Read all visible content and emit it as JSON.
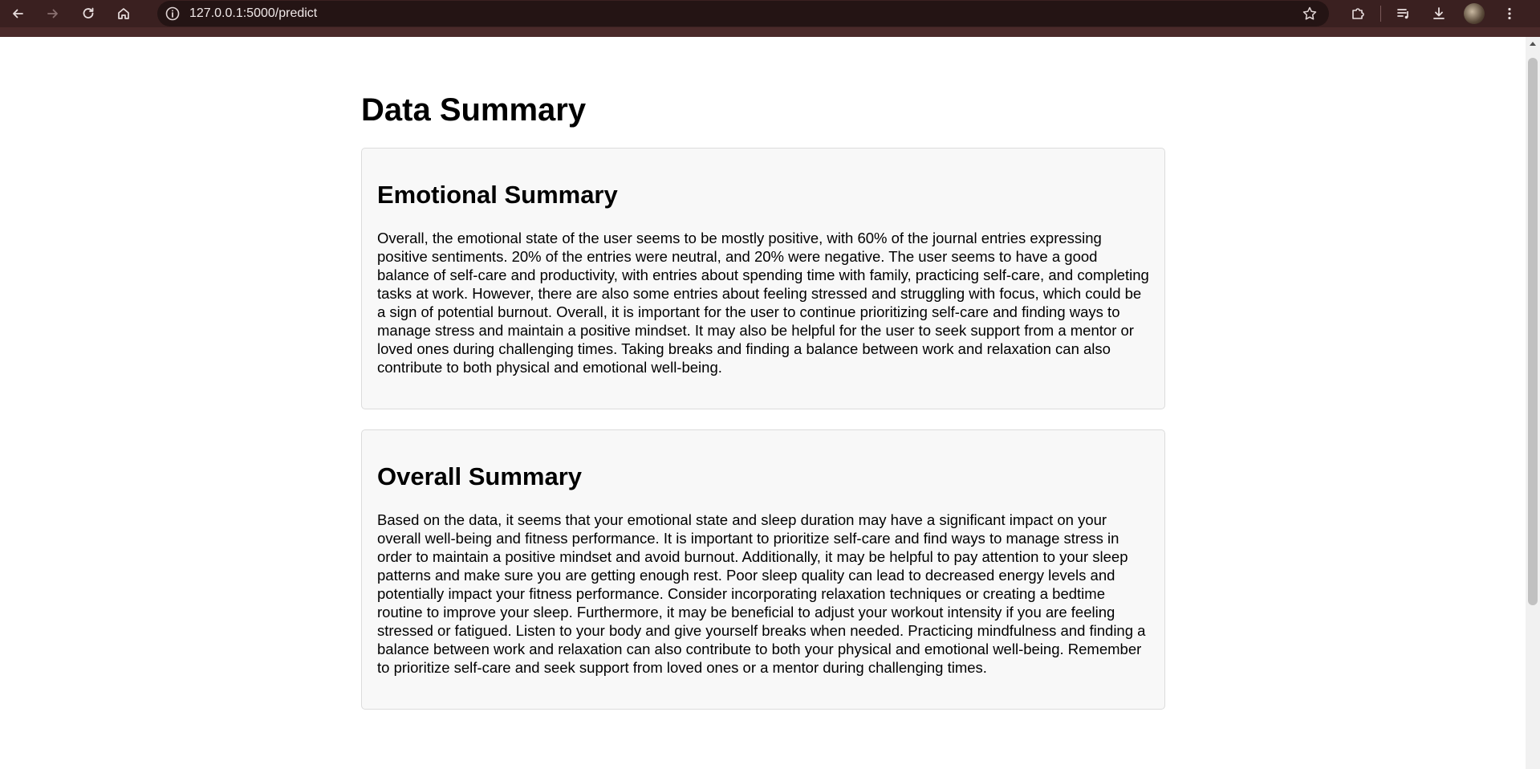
{
  "browser": {
    "url": "127.0.0.1:5000/predict"
  },
  "page": {
    "title": "Data Summary",
    "sections": [
      {
        "heading": "Emotional Summary",
        "body": "Overall, the emotional state of the user seems to be mostly positive, with 60% of the journal entries expressing positive sentiments. 20% of the entries were neutral, and 20% were negative. The user seems to have a good balance of self-care and productivity, with entries about spending time with family, practicing self-care, and completing tasks at work. However, there are also some entries about feeling stressed and struggling with focus, which could be a sign of potential burnout. Overall, it is important for the user to continue prioritizing self-care and finding ways to manage stress and maintain a positive mindset. It may also be helpful for the user to seek support from a mentor or loved ones during challenging times. Taking breaks and finding a balance between work and relaxation can also contribute to both physical and emotional well-being."
      },
      {
        "heading": "Overall Summary",
        "body": "Based on the data, it seems that your emotional state and sleep duration may have a significant impact on your overall well-being and fitness performance. It is important to prioritize self-care and find ways to manage stress in order to maintain a positive mindset and avoid burnout. Additionally, it may be helpful to pay attention to your sleep patterns and make sure you are getting enough rest. Poor sleep quality can lead to decreased energy levels and potentially impact your fitness performance. Consider incorporating relaxation techniques or creating a bedtime routine to improve your sleep. Furthermore, it may be beneficial to adjust your workout intensity if you are feeling stressed or fatigued. Listen to your body and give yourself breaks when needed. Practicing mindfulness and finding a balance between work and relaxation can also contribute to both your physical and emotional well-being. Remember to prioritize self-care and seek support from loved ones or a mentor during challenging times."
      }
    ]
  },
  "icons": {
    "back": "back-arrow-icon",
    "forward": "forward-arrow-icon",
    "reload": "reload-icon",
    "home": "home-icon",
    "site_info": "info-icon",
    "bookmark": "star-icon",
    "extensions": "puzzle-icon",
    "media": "playlist-icon",
    "downloads": "download-icon",
    "menu": "kebab-menu-icon"
  }
}
